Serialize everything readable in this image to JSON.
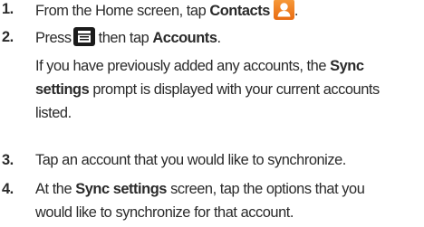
{
  "steps": [
    {
      "number": "1.",
      "text_before": "From the Home screen, tap ",
      "bold": "Contacts",
      "icon": "contacts-icon",
      "text_after": "."
    },
    {
      "number": "2.",
      "text_before": "Press",
      "icon": "menu-key-icon",
      "text_middle": "then tap ",
      "bold": "Accounts",
      "text_after": ".",
      "note": {
        "line1_before": "If you have previously added any accounts, the ",
        "line1_bold": "Sync",
        "line2_bold": "settings",
        "line2_after": " prompt is displayed with your current accounts",
        "line3": "listed."
      }
    },
    {
      "number": "3.",
      "text": "Tap an account that you would like to synchronize."
    },
    {
      "number": "4.",
      "line1_before": "At the ",
      "line1_bold": "Sync settings",
      "line1_after": " screen, tap the options that you",
      "line2": "would like to synchronize for that account."
    }
  ],
  "colors": {
    "contacts_icon": "#f0841f",
    "menu_key_icon": "#1b1b1b",
    "text": "#2a2a2a"
  }
}
